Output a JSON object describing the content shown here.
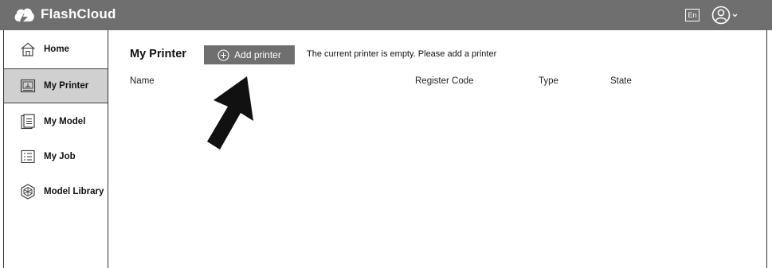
{
  "header": {
    "app_title": "FlashCloud",
    "logo_icon": "flashcloud-logo-icon",
    "language_label": "En",
    "user_icon": "user-avatar-icon"
  },
  "sidebar": {
    "items": [
      {
        "label": "Home",
        "icon": "home-icon",
        "active": false
      },
      {
        "label": "My Printer",
        "icon": "printer-icon",
        "active": true
      },
      {
        "label": "My Model",
        "icon": "model-icon",
        "active": false
      },
      {
        "label": "My Job",
        "icon": "job-list-icon",
        "active": false
      },
      {
        "label": "Model Library",
        "icon": "model-library-icon",
        "active": false
      }
    ]
  },
  "main": {
    "title": "My Printer",
    "add_button_label": "Add printer",
    "empty_message": "The current printer is empty. Please add a printer",
    "table": {
      "columns": [
        "Name",
        "Register Code",
        "Type",
        "State"
      ],
      "rows": []
    }
  },
  "colors": {
    "header_bg": "#6f6f6f",
    "active_nav_bg": "#d0d0d0",
    "button_bg": "#6f6f6f"
  }
}
